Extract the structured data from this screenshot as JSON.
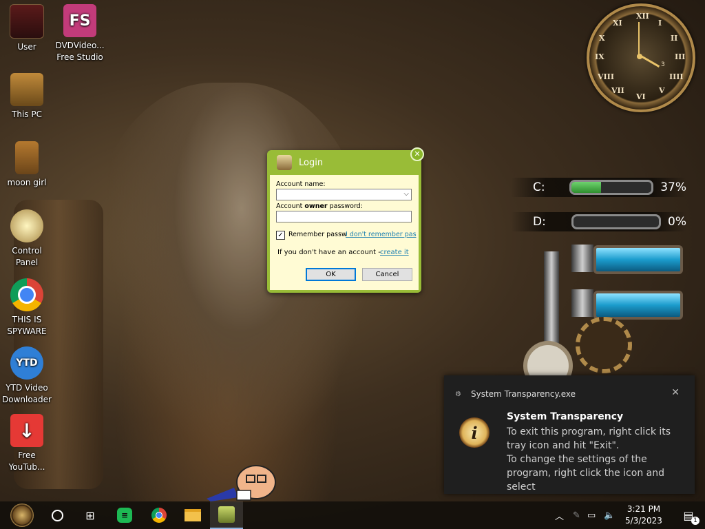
{
  "desktop_icons": [
    {
      "label": "User"
    },
    {
      "label": "DVDVideo... Free Studio",
      "badge": "FS"
    },
    {
      "label": "This PC"
    },
    {
      "label": "moon girl"
    },
    {
      "label": "Control Panel"
    },
    {
      "label": "THIS IS SPYWARE"
    },
    {
      "label": "YTD Video Downloader",
      "badge": "YTD"
    },
    {
      "label": "Free YouTub..."
    }
  ],
  "clock_widget": {
    "numerals": [
      "XII",
      "I",
      "II",
      "III",
      "IIII",
      "V",
      "VI",
      "VII",
      "VIII",
      "IX",
      "X",
      "XI"
    ],
    "date": "3"
  },
  "drives": [
    {
      "label": "C:",
      "percent_text": "37%",
      "fill": 0.37
    },
    {
      "label": "D:",
      "percent_text": "0%",
      "fill": 0.0
    }
  ],
  "login": {
    "title": "Login",
    "account_label": "Account name:",
    "password_label_pre": "Account ",
    "password_label_bold": "owner",
    "password_label_post": " password:",
    "account_value": "",
    "password_value": "",
    "remember_label": "Remember passw",
    "remember_checked": true,
    "forgot_link": "I don't remember pas",
    "no_account_text": "If you don't have an account - ",
    "create_link": "create it",
    "ok_label": "OK",
    "cancel_label": "Cancel"
  },
  "toast": {
    "app_name": "System Transparency.exe",
    "title": "System Transparency",
    "line1": "To exit this program, right click its tray icon and hit \"Exit\".",
    "line2": "To change the settings of the program, right click the icon and select"
  },
  "taskbar": {
    "time": "3:21 PM",
    "date": "5/3/2023",
    "notification_count": "1"
  },
  "colors": {
    "login_green": "#99bc37",
    "login_body": "#fffbd4",
    "toast_bg": "#1f1f1f"
  }
}
